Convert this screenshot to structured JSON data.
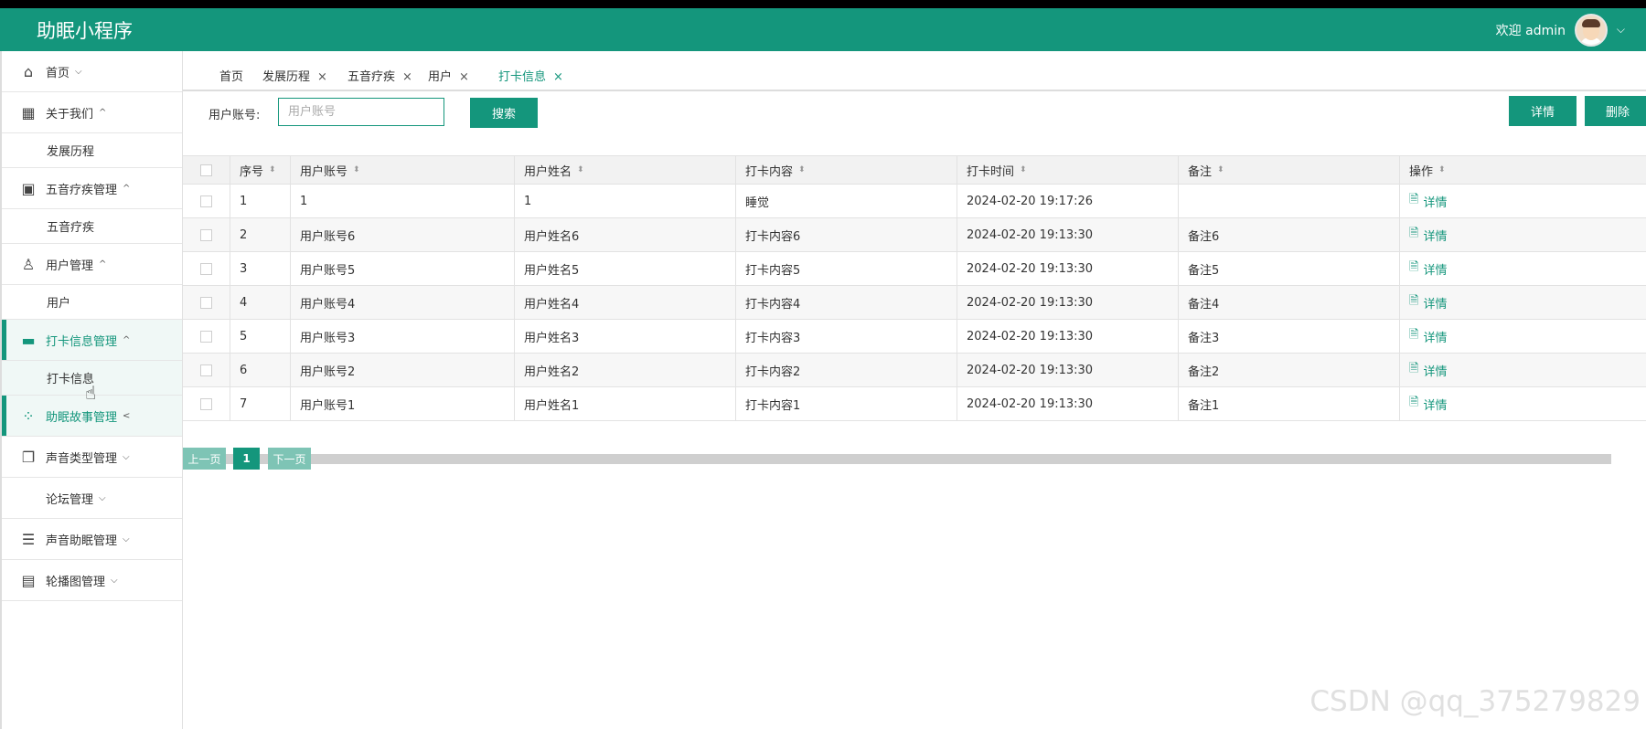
{
  "header": {
    "app_title": "助眠小程序",
    "welcome": "欢迎 admin",
    "chevron": "⌵"
  },
  "sidebar": {
    "items": [
      {
        "label": "首页",
        "icon": "home-icon",
        "arrow": "⌵"
      },
      {
        "label": "关于我们",
        "icon": "building-icon",
        "arrow": "^"
      },
      {
        "label": "发展历程",
        "sub": true
      },
      {
        "label": "五音疗疾管理",
        "icon": "chip-icon",
        "arrow": "^"
      },
      {
        "label": "五音疗疾",
        "sub": true
      },
      {
        "label": "用户管理",
        "icon": "user-icon",
        "arrow": "^"
      },
      {
        "label": "用户",
        "sub": true
      },
      {
        "label": "打卡信息管理",
        "icon": "card-icon",
        "arrow": "^",
        "active": true
      },
      {
        "label": "打卡信息",
        "sub": true,
        "active": true
      },
      {
        "label": "助眠故事管理",
        "icon": "apps-icon",
        "arrow": "<",
        "active": true
      },
      {
        "label": "声音类型管理",
        "icon": "copy-icon",
        "arrow": "⌵"
      },
      {
        "label": "论坛管理",
        "arrow": "⌵"
      },
      {
        "label": "声音助眠管理",
        "icon": "server-icon",
        "arrow": "⌵"
      },
      {
        "label": "轮播图管理",
        "icon": "layout-icon",
        "arrow": "⌵"
      }
    ]
  },
  "tabs": [
    {
      "label": "首页",
      "closable": false
    },
    {
      "label": "发展历程",
      "closable": true
    },
    {
      "label": "五音疗疾",
      "closable": true
    },
    {
      "label": "用户",
      "closable": true
    },
    {
      "label": "打卡信息",
      "closable": true,
      "active": true
    }
  ],
  "close_glyph": "×",
  "search": {
    "label": "用户账号:",
    "placeholder": "用户账号",
    "value": "",
    "button": "搜索"
  },
  "toolbar": {
    "detail_label": "详情",
    "delete_label": "删除"
  },
  "table": {
    "columns": [
      "序号",
      "用户账号",
      "用户姓名",
      "打卡内容",
      "打卡时间",
      "备注",
      "操作"
    ],
    "sort_glyph": "⬍",
    "action_label": "详情",
    "rows": [
      [
        "1",
        "1",
        "1",
        "睡觉",
        "2024-02-20 19:17:26",
        ""
      ],
      [
        "2",
        "用户账号6",
        "用户姓名6",
        "打卡内容6",
        "2024-02-20 19:13:30",
        "备注6"
      ],
      [
        "3",
        "用户账号5",
        "用户姓名5",
        "打卡内容5",
        "2024-02-20 19:13:30",
        "备注5"
      ],
      [
        "4",
        "用户账号4",
        "用户姓名4",
        "打卡内容4",
        "2024-02-20 19:13:30",
        "备注4"
      ],
      [
        "5",
        "用户账号3",
        "用户姓名3",
        "打卡内容3",
        "2024-02-20 19:13:30",
        "备注3"
      ],
      [
        "6",
        "用户账号2",
        "用户姓名2",
        "打卡内容2",
        "2024-02-20 19:13:30",
        "备注2"
      ],
      [
        "7",
        "用户账号1",
        "用户姓名1",
        "打卡内容1",
        "2024-02-20 19:13:30",
        "备注1"
      ]
    ]
  },
  "pager": {
    "prev": "上一页",
    "current": "1",
    "next": "下一页"
  },
  "watermark": "CSDN @qq_375279829",
  "colors": {
    "accent": "#14967c"
  }
}
